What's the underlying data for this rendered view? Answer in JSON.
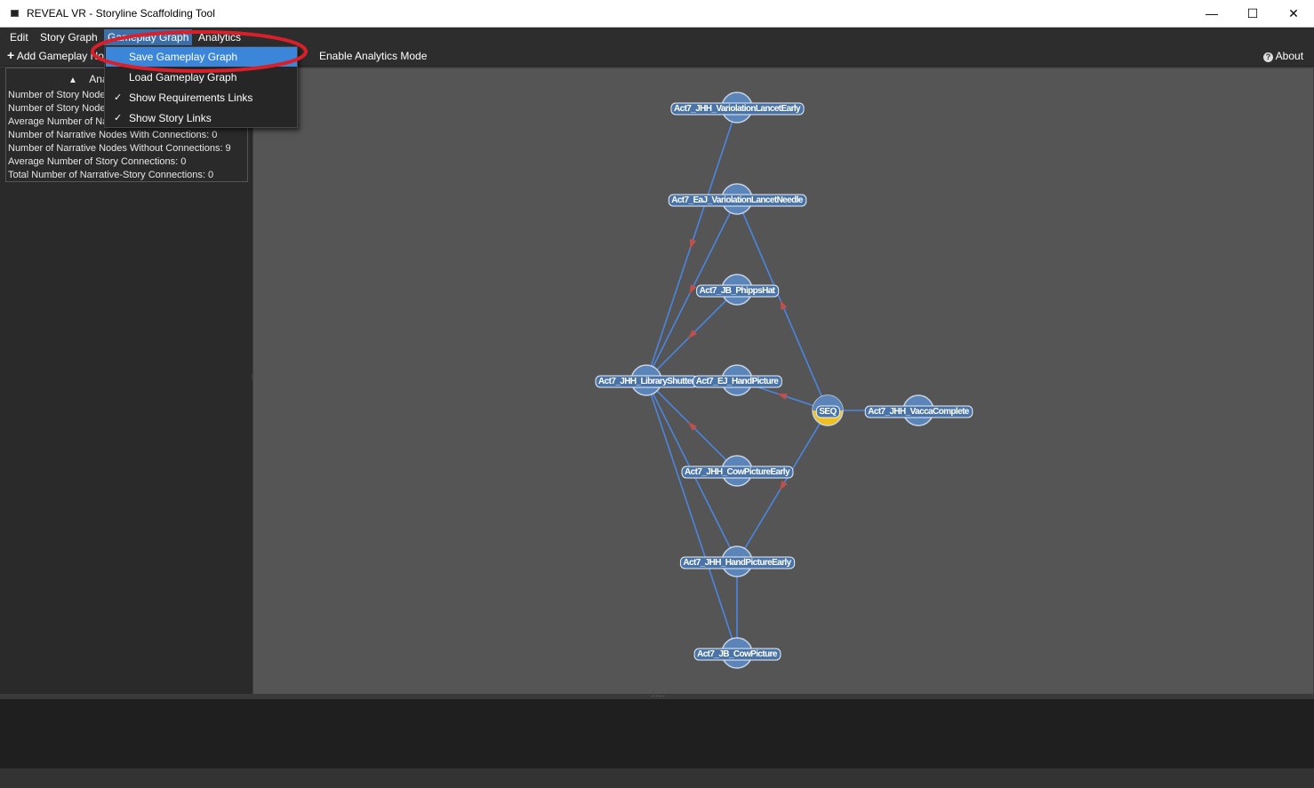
{
  "window": {
    "title": "REVEAL VR - Storyline Scaffolding Tool",
    "minimize": "—",
    "maximize": "☐",
    "close": "✕"
  },
  "menubar": {
    "items": [
      "Edit",
      "Story Graph",
      "Gameplay Graph",
      "Analytics"
    ]
  },
  "toolbar": {
    "add_node": "Add Gameplay No",
    "analytics_mode": "Enable Analytics Mode",
    "about": "About"
  },
  "dropdown": {
    "items": [
      {
        "label": "Save Gameplay Graph",
        "checked": false,
        "highlighted": true
      },
      {
        "label": "Load Gameplay Graph",
        "checked": false,
        "highlighted": false
      },
      {
        "label": "Show Requirements Links",
        "checked": true,
        "highlighted": false
      },
      {
        "label": "Show Story Links",
        "checked": true,
        "highlighted": false
      }
    ],
    "check_glyph": "✓"
  },
  "analytics": {
    "header": "Anal",
    "toggle_glyph": "▲",
    "stats": [
      "Number of Story Nodes",
      "Number of Story Nodes",
      "Average Number of Na",
      "Number of Narrative Nodes With Connections: 0",
      "Number of Narrative Nodes Without Connections: 9",
      "Average Number of Story Connections: 0",
      "Total Number of Narrative-Story Connections: 0"
    ]
  },
  "graph": {
    "nodes": [
      {
        "id": "n1",
        "label": "Act7_JHH_VariolationLancetEarly",
        "type": "narrative"
      },
      {
        "id": "n2",
        "label": "Act7_EaJ_VariolationLancetNeedle",
        "type": "narrative"
      },
      {
        "id": "n3",
        "label": "Act7_JB_PhippsHat",
        "type": "narrative"
      },
      {
        "id": "n4",
        "label": "Act7_JHH_LibraryShutter",
        "type": "narrative"
      },
      {
        "id": "n5",
        "label": "Act7_EJ_HandPicture",
        "type": "narrative"
      },
      {
        "id": "n6",
        "label": "SEQ",
        "type": "sequence"
      },
      {
        "id": "n7",
        "label": "Act7_JHH_VaccaComplete",
        "type": "narrative"
      },
      {
        "id": "n8",
        "label": "Act7_JHH_CowPictureEarly",
        "type": "narrative"
      },
      {
        "id": "n9",
        "label": "Act7_JHH_HandPictureEarly",
        "type": "narrative"
      },
      {
        "id": "n10",
        "label": "Act7_JB_CowPicture",
        "type": "narrative"
      }
    ],
    "colors": {
      "node": "#5b85b8",
      "sequence": "#f0c020",
      "edge": "#4a86e0",
      "arrow": "#c0504d",
      "canvas": "#555555"
    }
  }
}
